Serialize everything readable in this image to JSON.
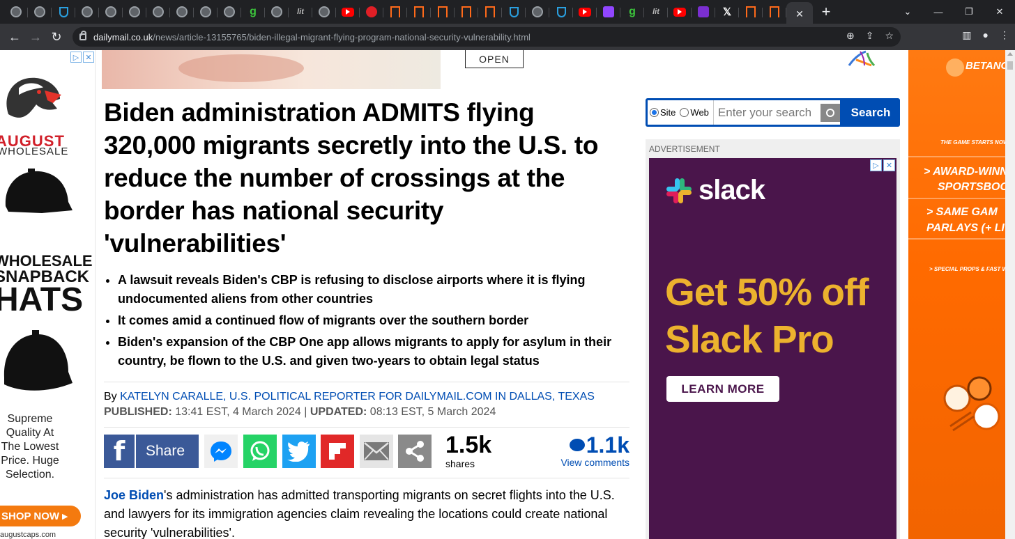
{
  "browser": {
    "tabs": [
      {
        "icon": "globe-icon",
        "kind": "globe"
      },
      {
        "icon": "globe-icon",
        "kind": "globe"
      },
      {
        "icon": "shield-icon",
        "kind": "sh"
      },
      {
        "icon": "globe-icon",
        "kind": "globe"
      },
      {
        "icon": "globe-icon",
        "kind": "globe"
      },
      {
        "icon": "globe-icon",
        "kind": "globe"
      },
      {
        "icon": "globe-icon",
        "kind": "globe"
      },
      {
        "icon": "globe-icon",
        "kind": "globe"
      },
      {
        "icon": "globe-icon",
        "kind": "globe"
      },
      {
        "icon": "globe-icon",
        "kind": "globe"
      },
      {
        "icon": "g-icon",
        "kind": "g",
        "glyph": "g"
      },
      {
        "icon": "globe-icon",
        "kind": "globe"
      },
      {
        "icon": "news-icon",
        "kind": "nt",
        "glyph": "lit"
      },
      {
        "icon": "globe-icon",
        "kind": "globe"
      },
      {
        "icon": "youtube-icon",
        "kind": "yt"
      },
      {
        "icon": "red-icon",
        "kind": "rd"
      },
      {
        "icon": "bookmark-icon",
        "kind": "bk"
      },
      {
        "icon": "bookmark-icon",
        "kind": "bk"
      },
      {
        "icon": "bookmark-icon",
        "kind": "bk"
      },
      {
        "icon": "bookmark-icon",
        "kind": "bk"
      },
      {
        "icon": "bookmark-icon",
        "kind": "bk"
      },
      {
        "icon": "shield-icon",
        "kind": "sh"
      },
      {
        "icon": "globe-icon",
        "kind": "globe"
      },
      {
        "icon": "shield-icon",
        "kind": "sh"
      },
      {
        "icon": "youtube-icon",
        "kind": "yt"
      },
      {
        "icon": "twitch-icon",
        "kind": "tw"
      },
      {
        "icon": "g-icon",
        "kind": "g",
        "glyph": "g"
      },
      {
        "icon": "news-icon",
        "kind": "nt",
        "glyph": "lit"
      },
      {
        "icon": "youtube-icon",
        "kind": "yt"
      },
      {
        "icon": "mail-icon",
        "kind": "ml"
      },
      {
        "icon": "x-icon",
        "kind": "x",
        "glyph": "𝕏"
      },
      {
        "icon": "bookmark-icon",
        "kind": "bk"
      },
      {
        "icon": "bookmark-icon",
        "kind": "bk"
      }
    ],
    "active_tab_close": "✕",
    "new_tab": "+",
    "window_controls": {
      "dropdown": "⌄",
      "minimize": "—",
      "restore": "❐",
      "close": "✕"
    },
    "url_domain": "dailymail.co.uk",
    "url_path": "/news/article-13155765/biden-illegal-migrant-flying-program-national-security-vulnerability.html",
    "nav": {
      "back": "←",
      "forward": "→",
      "reload": "↻"
    },
    "omni_icons": {
      "zoom": "⊕",
      "share": "⇪",
      "star": "☆"
    },
    "toolbar_icons": {
      "sidepanel": "▥",
      "profile": "●",
      "menu": "⋮"
    }
  },
  "left_ad": {
    "close": "✕",
    "info": "▷",
    "brand": "AUGUST",
    "brand_sub": "WHOLESALE",
    "line1": "WHOLESALE",
    "line2": "SNAPBACK",
    "line3": "HATS",
    "tagline": "Supreme Quality At The Lowest Price. Huge Selection.",
    "cta": "SHOP NOW ▸",
    "footer": "augustcaps.com"
  },
  "top_banner": {
    "cta": "OPEN"
  },
  "article": {
    "headline": "Biden administration ADMITS flying 320,000 migrants secretly into the U.S. to reduce the number of crossings at the border has national security 'vulnerabilities'",
    "bullets": [
      "A lawsuit reveals Biden's CBP is refusing to disclose airports where it is flying undocumented aliens from other countries",
      "It comes amid a continued flow of migrants over the southern border",
      "Biden's expansion of the CBP One app allows migrants to apply for asylum in their country, be flown to the U.S. and given two-years to obtain legal status"
    ],
    "by_prefix": "By",
    "author": "KATELYN CARALLE, U.S. POLITICAL REPORTER FOR DAILYMAIL.COM IN DALLAS, TEXAS",
    "published_label": "PUBLISHED:",
    "published": "13:41 EST, 4 March 2024",
    "separator": "|",
    "updated_label": "UPDATED:",
    "updated": "08:13 EST, 5 March 2024",
    "share": {
      "facebook_label": "Share",
      "count": "1.5k",
      "count_label": "shares",
      "comments_count": "1.1k",
      "comments_label": "View comments"
    },
    "body_link": "Joe Biden",
    "body_rest": "'s administration has admitted transporting migrants on secret flights into the U.S. and lawyers for its immigration agencies claim revealing the locations could create national security 'vulnerabilities'."
  },
  "search": {
    "option_site": "Site",
    "option_web": "Web",
    "placeholder": "Enter your search",
    "button": "Search"
  },
  "right_ad": {
    "label": "ADVERTISEMENT",
    "brand": "slack",
    "promo_line1": "Get 50% off",
    "promo_line2": "Slack Pro",
    "cta": "LEARN MORE"
  },
  "far_right_ad": {
    "brand": "BETANO",
    "kicker": "THE GAME STARTS NOW",
    "line1": "> AWARD-WINN",
    "line2": "SPORTSBOO",
    "line3": "> SAME GAM",
    "line4": "PARLAYS (+ LI",
    "small": "> SPECIAL PROPS & FAST WITHDR"
  },
  "colors": {
    "link": "#004db3",
    "slack_bg": "#4a154b",
    "slack_yellow": "#ecb22e",
    "facebook": "#3b5998",
    "messenger": "#0084ff",
    "whatsapp": "#25d366",
    "twitter": "#1da1f2",
    "flipboard": "#e12828",
    "email": "#7a7a7a",
    "share_more": "#8a8a8a",
    "betano_orange": "#ff6a00"
  }
}
